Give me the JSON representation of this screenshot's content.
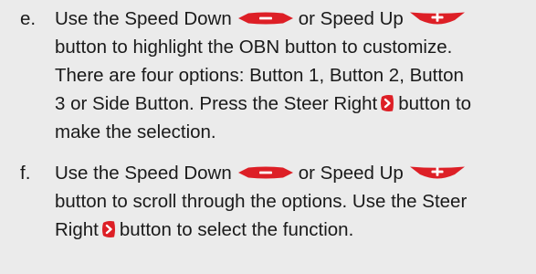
{
  "steps": [
    {
      "letter": "e.",
      "lines": [
        {
          "a": "Use the Speed Down",
          "b": "or Speed Up"
        },
        {
          "text": "button to highlight the OBN button to customize."
        },
        {
          "text": "There are four options: Button 1, Button 2, Button"
        },
        {
          "a": "3 or Side Button. Press the Steer Right",
          "b": "button to"
        },
        {
          "text": "make the selection."
        }
      ]
    },
    {
      "letter": "f.",
      "lines": [
        {
          "a": "Use the Speed Down",
          "b": "or Speed Up"
        },
        {
          "text": "button to scroll through the options. Use the Steer"
        },
        {
          "a": "Right",
          "b": "button to select the function."
        }
      ]
    }
  ],
  "icons": {
    "speed_down": "speed-down-button-icon",
    "speed_up": "speed-up-button-icon",
    "steer_right": "steer-right-button-icon"
  },
  "colors": {
    "background": "#ebebeb",
    "text": "#1a1a1a",
    "button_red": "#dd1f26"
  }
}
